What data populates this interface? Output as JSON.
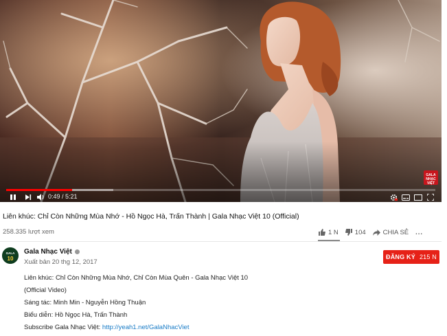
{
  "player": {
    "time_current": "0:49",
    "time_separator": " / ",
    "time_total": "5:21",
    "progress_played": 0.153,
    "progress_buffered": 0.25,
    "watermark_text": "GALA NHẠC VIỆT",
    "accent_color": "#ff0000"
  },
  "video": {
    "title": "Liên khúc: Chỉ Còn Những Mùa Nhớ - Hồ Ngọc Hà, Trấn Thành | Gala Nhạc Việt 10 (Official)",
    "views": "258.335 lượt xem",
    "like_count": "1 N",
    "dislike_count": "104",
    "share_label": "CHIA SẺ",
    "more_label": "..."
  },
  "channel": {
    "name": "Gala Nhạc Việt",
    "avatar_text": "GALA 10",
    "published": "Xuất bản 20 thg 12, 2017",
    "subscribe_label": "ĐĂNG KÝ",
    "subscriber_count": "215 N",
    "subscribe_color": "#e62117"
  },
  "description": {
    "line1": "Liên khúc: Chỉ Còn Những Mùa Nhớ, Chỉ Còn Mùa Quên - Gala Nhạc Việt 10",
    "line2": "(Official Video)",
    "line3": "Sáng tác: Minh Min - Nguyễn Hồng Thuận",
    "line4": "Biểu diễn: Hồ Ngọc Hà, Trấn Thành",
    "line5_prefix": "Subscribe Gala Nhạc Việt: ",
    "line5_link": "http://yeah1.net/GalaNhacViet"
  },
  "icons": {
    "play_pause": "pause-icon",
    "next": "next-icon",
    "volume": "volume-icon",
    "settings": "gear-icon",
    "subtitles": "subtitles-icon",
    "miniplayer": "miniplayer-icon",
    "theater": "theater-icon",
    "fullscreen": "fullscreen-icon",
    "like": "thumbs-up-icon",
    "dislike": "thumbs-down-icon",
    "share": "share-icon",
    "verified": "verified-icon"
  }
}
